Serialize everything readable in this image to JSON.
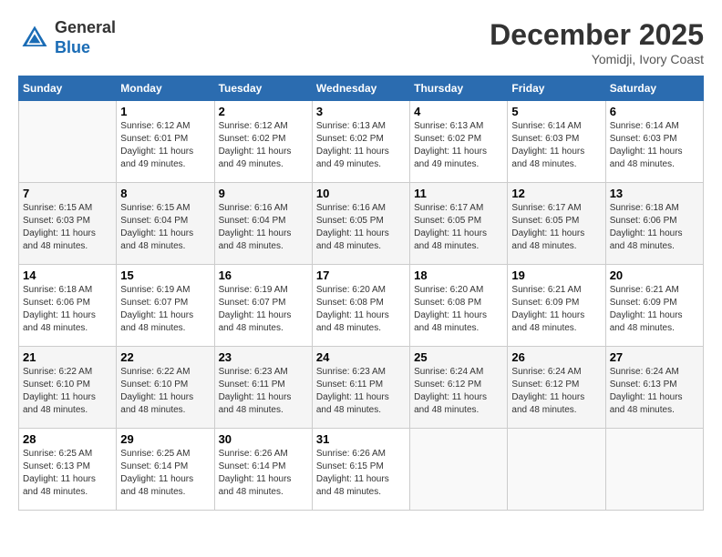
{
  "header": {
    "logo_line1": "General",
    "logo_line2": "Blue",
    "month": "December 2025",
    "location": "Yomidji, Ivory Coast"
  },
  "days_of_week": [
    "Sunday",
    "Monday",
    "Tuesday",
    "Wednesday",
    "Thursday",
    "Friday",
    "Saturday"
  ],
  "weeks": [
    [
      {
        "day": "",
        "sunrise": "",
        "sunset": "",
        "daylight": ""
      },
      {
        "day": "1",
        "sunrise": "Sunrise: 6:12 AM",
        "sunset": "Sunset: 6:01 PM",
        "daylight": "Daylight: 11 hours and 49 minutes."
      },
      {
        "day": "2",
        "sunrise": "Sunrise: 6:12 AM",
        "sunset": "Sunset: 6:02 PM",
        "daylight": "Daylight: 11 hours and 49 minutes."
      },
      {
        "day": "3",
        "sunrise": "Sunrise: 6:13 AM",
        "sunset": "Sunset: 6:02 PM",
        "daylight": "Daylight: 11 hours and 49 minutes."
      },
      {
        "day": "4",
        "sunrise": "Sunrise: 6:13 AM",
        "sunset": "Sunset: 6:02 PM",
        "daylight": "Daylight: 11 hours and 49 minutes."
      },
      {
        "day": "5",
        "sunrise": "Sunrise: 6:14 AM",
        "sunset": "Sunset: 6:03 PM",
        "daylight": "Daylight: 11 hours and 48 minutes."
      },
      {
        "day": "6",
        "sunrise": "Sunrise: 6:14 AM",
        "sunset": "Sunset: 6:03 PM",
        "daylight": "Daylight: 11 hours and 48 minutes."
      }
    ],
    [
      {
        "day": "7",
        "sunrise": "Sunrise: 6:15 AM",
        "sunset": "Sunset: 6:03 PM",
        "daylight": "Daylight: 11 hours and 48 minutes."
      },
      {
        "day": "8",
        "sunrise": "Sunrise: 6:15 AM",
        "sunset": "Sunset: 6:04 PM",
        "daylight": "Daylight: 11 hours and 48 minutes."
      },
      {
        "day": "9",
        "sunrise": "Sunrise: 6:16 AM",
        "sunset": "Sunset: 6:04 PM",
        "daylight": "Daylight: 11 hours and 48 minutes."
      },
      {
        "day": "10",
        "sunrise": "Sunrise: 6:16 AM",
        "sunset": "Sunset: 6:05 PM",
        "daylight": "Daylight: 11 hours and 48 minutes."
      },
      {
        "day": "11",
        "sunrise": "Sunrise: 6:17 AM",
        "sunset": "Sunset: 6:05 PM",
        "daylight": "Daylight: 11 hours and 48 minutes."
      },
      {
        "day": "12",
        "sunrise": "Sunrise: 6:17 AM",
        "sunset": "Sunset: 6:05 PM",
        "daylight": "Daylight: 11 hours and 48 minutes."
      },
      {
        "day": "13",
        "sunrise": "Sunrise: 6:18 AM",
        "sunset": "Sunset: 6:06 PM",
        "daylight": "Daylight: 11 hours and 48 minutes."
      }
    ],
    [
      {
        "day": "14",
        "sunrise": "Sunrise: 6:18 AM",
        "sunset": "Sunset: 6:06 PM",
        "daylight": "Daylight: 11 hours and 48 minutes."
      },
      {
        "day": "15",
        "sunrise": "Sunrise: 6:19 AM",
        "sunset": "Sunset: 6:07 PM",
        "daylight": "Daylight: 11 hours and 48 minutes."
      },
      {
        "day": "16",
        "sunrise": "Sunrise: 6:19 AM",
        "sunset": "Sunset: 6:07 PM",
        "daylight": "Daylight: 11 hours and 48 minutes."
      },
      {
        "day": "17",
        "sunrise": "Sunrise: 6:20 AM",
        "sunset": "Sunset: 6:08 PM",
        "daylight": "Daylight: 11 hours and 48 minutes."
      },
      {
        "day": "18",
        "sunrise": "Sunrise: 6:20 AM",
        "sunset": "Sunset: 6:08 PM",
        "daylight": "Daylight: 11 hours and 48 minutes."
      },
      {
        "day": "19",
        "sunrise": "Sunrise: 6:21 AM",
        "sunset": "Sunset: 6:09 PM",
        "daylight": "Daylight: 11 hours and 48 minutes."
      },
      {
        "day": "20",
        "sunrise": "Sunrise: 6:21 AM",
        "sunset": "Sunset: 6:09 PM",
        "daylight": "Daylight: 11 hours and 48 minutes."
      }
    ],
    [
      {
        "day": "21",
        "sunrise": "Sunrise: 6:22 AM",
        "sunset": "Sunset: 6:10 PM",
        "daylight": "Daylight: 11 hours and 48 minutes."
      },
      {
        "day": "22",
        "sunrise": "Sunrise: 6:22 AM",
        "sunset": "Sunset: 6:10 PM",
        "daylight": "Daylight: 11 hours and 48 minutes."
      },
      {
        "day": "23",
        "sunrise": "Sunrise: 6:23 AM",
        "sunset": "Sunset: 6:11 PM",
        "daylight": "Daylight: 11 hours and 48 minutes."
      },
      {
        "day": "24",
        "sunrise": "Sunrise: 6:23 AM",
        "sunset": "Sunset: 6:11 PM",
        "daylight": "Daylight: 11 hours and 48 minutes."
      },
      {
        "day": "25",
        "sunrise": "Sunrise: 6:24 AM",
        "sunset": "Sunset: 6:12 PM",
        "daylight": "Daylight: 11 hours and 48 minutes."
      },
      {
        "day": "26",
        "sunrise": "Sunrise: 6:24 AM",
        "sunset": "Sunset: 6:12 PM",
        "daylight": "Daylight: 11 hours and 48 minutes."
      },
      {
        "day": "27",
        "sunrise": "Sunrise: 6:24 AM",
        "sunset": "Sunset: 6:13 PM",
        "daylight": "Daylight: 11 hours and 48 minutes."
      }
    ],
    [
      {
        "day": "28",
        "sunrise": "Sunrise: 6:25 AM",
        "sunset": "Sunset: 6:13 PM",
        "daylight": "Daylight: 11 hours and 48 minutes."
      },
      {
        "day": "29",
        "sunrise": "Sunrise: 6:25 AM",
        "sunset": "Sunset: 6:14 PM",
        "daylight": "Daylight: 11 hours and 48 minutes."
      },
      {
        "day": "30",
        "sunrise": "Sunrise: 6:26 AM",
        "sunset": "Sunset: 6:14 PM",
        "daylight": "Daylight: 11 hours and 48 minutes."
      },
      {
        "day": "31",
        "sunrise": "Sunrise: 6:26 AM",
        "sunset": "Sunset: 6:15 PM",
        "daylight": "Daylight: 11 hours and 48 minutes."
      },
      {
        "day": "",
        "sunrise": "",
        "sunset": "",
        "daylight": ""
      },
      {
        "day": "",
        "sunrise": "",
        "sunset": "",
        "daylight": ""
      },
      {
        "day": "",
        "sunrise": "",
        "sunset": "",
        "daylight": ""
      }
    ]
  ]
}
